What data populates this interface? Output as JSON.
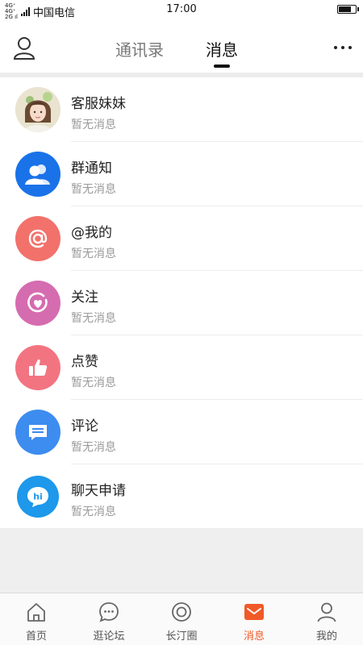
{
  "status_bar": {
    "network_top": "4G⁺ 4G⁺",
    "network_bottom": "2G ıl",
    "carrier": "中国电信",
    "time": "17:00",
    "battery_level": 0.8
  },
  "header": {
    "tabs": [
      {
        "label": "通讯录",
        "active": false
      },
      {
        "label": "消息",
        "active": true
      }
    ]
  },
  "messages": [
    {
      "title": "客服妹妹",
      "subtitle": "暂无消息",
      "icon": "customer-service-avatar",
      "color": "#f0ead8"
    },
    {
      "title": "群通知",
      "subtitle": "暂无消息",
      "icon": "group-people-icon",
      "color": "#1a72e8"
    },
    {
      "title": "@我的",
      "subtitle": "暂无消息",
      "icon": "at-sign-icon",
      "color": "#f2716b"
    },
    {
      "title": "关注",
      "subtitle": "暂无消息",
      "icon": "heart-follow-icon",
      "color": "#d56cb0"
    },
    {
      "title": "点赞",
      "subtitle": "暂无消息",
      "icon": "thumbs-up-icon",
      "color": "#f37481"
    },
    {
      "title": "评论",
      "subtitle": "暂无消息",
      "icon": "comment-icon",
      "color": "#3d8cf0"
    },
    {
      "title": "聊天申请",
      "subtitle": "暂无消息",
      "icon": "hi-chat-icon",
      "color": "#1d98ea"
    }
  ],
  "bottom_nav": [
    {
      "label": "首页",
      "icon": "home-icon",
      "active": false
    },
    {
      "label": "逛论坛",
      "icon": "forum-bubble-icon",
      "active": false
    },
    {
      "label": "长汀圈",
      "icon": "circle-icon",
      "active": false
    },
    {
      "label": "消息",
      "icon": "message-envelope-icon",
      "active": true
    },
    {
      "label": "我的",
      "icon": "profile-icon",
      "active": false
    }
  ],
  "colors": {
    "accent": "#f05a28",
    "separator": "#ececec"
  }
}
